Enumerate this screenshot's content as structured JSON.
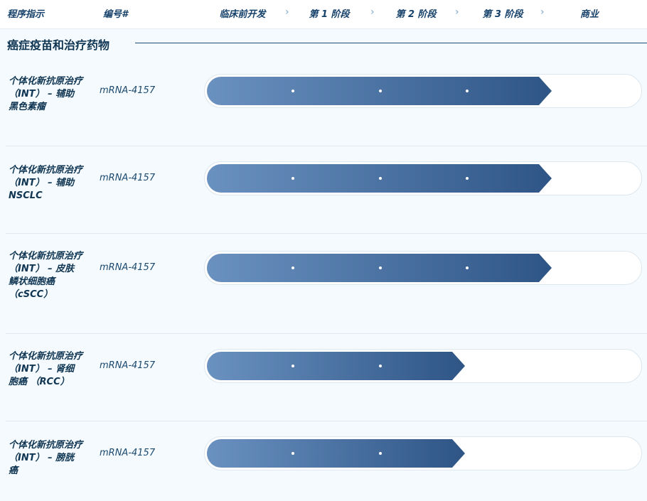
{
  "header": {
    "program": "程序指示",
    "code": "编号#",
    "stages": [
      "临床前开发",
      "第 1 阶段",
      "第 2 阶段",
      "第 3 阶段",
      "商业"
    ],
    "chevron_icon": "chevron-right-icon"
  },
  "section": {
    "title": "癌症疫苗和治疗药物"
  },
  "rows": [
    {
      "name": "个体化新抗原治疗 （INT） – 辅助黑色素瘤",
      "code": "mRNA-4157",
      "progress_stage": 3
    },
    {
      "name": "个体化新抗原治疗 （INT） – 辅助 NSCLC",
      "code": "mRNA-4157",
      "progress_stage": 3
    },
    {
      "name": "个体化新抗原治疗 （INT） – 皮肤鳞状细胞癌 （cSCC）",
      "code": "mRNA-4157",
      "progress_stage": 3
    },
    {
      "name": "个体化新抗原治疗 （INT） – 肾细胞癌 （RCC）",
      "code": "mRNA-4157",
      "progress_stage": 2
    },
    {
      "name": "个体化新抗原治疗 （INT） – 膀胱癌",
      "code": "mRNA-4157",
      "progress_stage": 2
    }
  ],
  "colors": {
    "bar_start": "#6a91c0",
    "bar_end": "#2e5585",
    "text": "#0f3552"
  }
}
